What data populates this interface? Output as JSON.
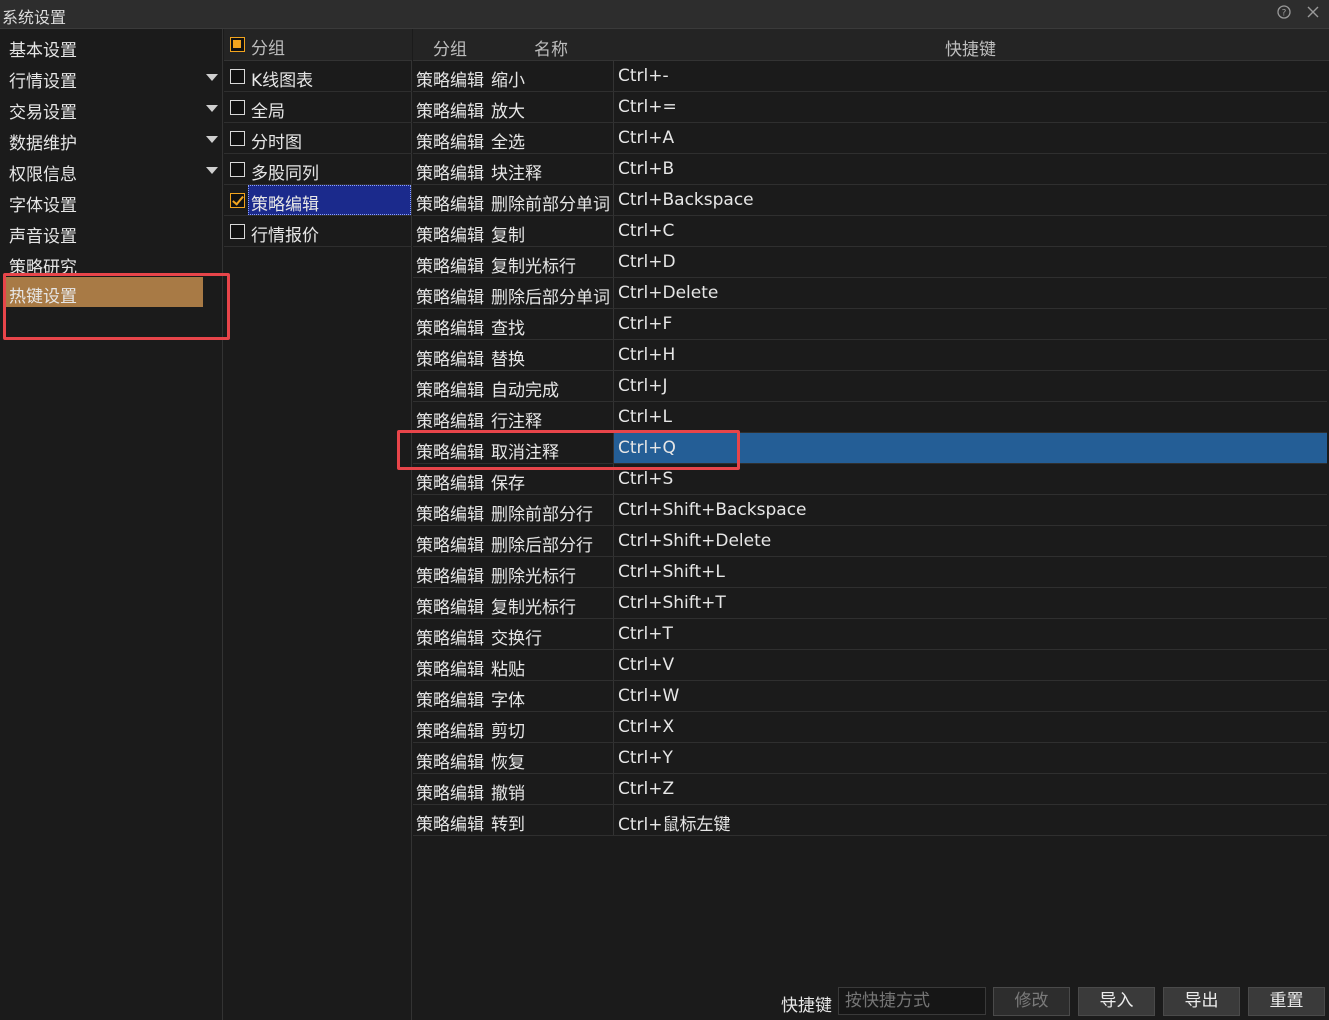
{
  "window": {
    "title": "系统设置",
    "help_icon": "question-circle-icon",
    "close_icon": "close-icon"
  },
  "nav": {
    "items": [
      {
        "label": "基本设置",
        "expandable": false
      },
      {
        "label": "行情设置",
        "expandable": true
      },
      {
        "label": "交易设置",
        "expandable": true
      },
      {
        "label": "数据维护",
        "expandable": true
      },
      {
        "label": "权限信息",
        "expandable": true
      },
      {
        "label": "字体设置",
        "expandable": false
      },
      {
        "label": "声音设置",
        "expandable": false
      },
      {
        "label": "策略研究",
        "expandable": false
      },
      {
        "label": "热键设置",
        "expandable": false,
        "selected": true
      }
    ]
  },
  "groups": {
    "header": "分组",
    "items": [
      {
        "label": "K线图表",
        "checked": false
      },
      {
        "label": "全局",
        "checked": false
      },
      {
        "label": "分时图",
        "checked": false
      },
      {
        "label": "多股同列",
        "checked": false
      },
      {
        "label": "策略编辑",
        "checked": true,
        "selected": true
      },
      {
        "label": "行情报价",
        "checked": false
      }
    ]
  },
  "table": {
    "headers": {
      "group": "分组",
      "name": "名称",
      "hotkey": "快捷键"
    },
    "rows": [
      {
        "group": "策略编辑",
        "name": "缩小",
        "hotkey": "Ctrl+-"
      },
      {
        "group": "策略编辑",
        "name": "放大",
        "hotkey": "Ctrl+="
      },
      {
        "group": "策略编辑",
        "name": "全选",
        "hotkey": "Ctrl+A"
      },
      {
        "group": "策略编辑",
        "name": "块注释",
        "hotkey": "Ctrl+B"
      },
      {
        "group": "策略编辑",
        "name": "删除前部分单词",
        "hotkey": "Ctrl+Backspace"
      },
      {
        "group": "策略编辑",
        "name": "复制",
        "hotkey": "Ctrl+C"
      },
      {
        "group": "策略编辑",
        "name": "复制光标行",
        "hotkey": "Ctrl+D"
      },
      {
        "group": "策略编辑",
        "name": "删除后部分单词",
        "hotkey": "Ctrl+Delete"
      },
      {
        "group": "策略编辑",
        "name": "查找",
        "hotkey": "Ctrl+F"
      },
      {
        "group": "策略编辑",
        "name": "替换",
        "hotkey": "Ctrl+H"
      },
      {
        "group": "策略编辑",
        "name": "自动完成",
        "hotkey": "Ctrl+J"
      },
      {
        "group": "策略编辑",
        "name": "行注释",
        "hotkey": "Ctrl+L"
      },
      {
        "group": "策略编辑",
        "name": "取消注释",
        "hotkey": "Ctrl+Q",
        "active": true
      },
      {
        "group": "策略编辑",
        "name": "保存",
        "hotkey": "Ctrl+S"
      },
      {
        "group": "策略编辑",
        "name": "删除前部分行",
        "hotkey": "Ctrl+Shift+Backspace"
      },
      {
        "group": "策略编辑",
        "name": "删除后部分行",
        "hotkey": "Ctrl+Shift+Delete"
      },
      {
        "group": "策略编辑",
        "name": "删除光标行",
        "hotkey": "Ctrl+Shift+L"
      },
      {
        "group": "策略编辑",
        "name": "复制光标行",
        "hotkey": "Ctrl+Shift+T"
      },
      {
        "group": "策略编辑",
        "name": "交换行",
        "hotkey": "Ctrl+T"
      },
      {
        "group": "策略编辑",
        "name": "粘贴",
        "hotkey": "Ctrl+V"
      },
      {
        "group": "策略编辑",
        "name": "字体",
        "hotkey": "Ctrl+W"
      },
      {
        "group": "策略编辑",
        "name": "剪切",
        "hotkey": "Ctrl+X"
      },
      {
        "group": "策略编辑",
        "name": "恢复",
        "hotkey": "Ctrl+Y"
      },
      {
        "group": "策略编辑",
        "name": "撤销",
        "hotkey": "Ctrl+Z"
      },
      {
        "group": "策略编辑",
        "name": "转到",
        "hotkey": "Ctrl+鼠标左键"
      }
    ]
  },
  "bottom": {
    "hotkey_label": "快捷键",
    "hotkey_placeholder": "按快捷方式",
    "modify_label": "修改",
    "import_label": "导入",
    "export_label": "导出",
    "reset_label": "重置"
  },
  "colors": {
    "nav_selected": "#a87a45",
    "group_selected": "#1b2a8c",
    "row_active": "#245e96",
    "checkbox_accent": "#f2a41e",
    "annotation_red": "#e8454a"
  }
}
